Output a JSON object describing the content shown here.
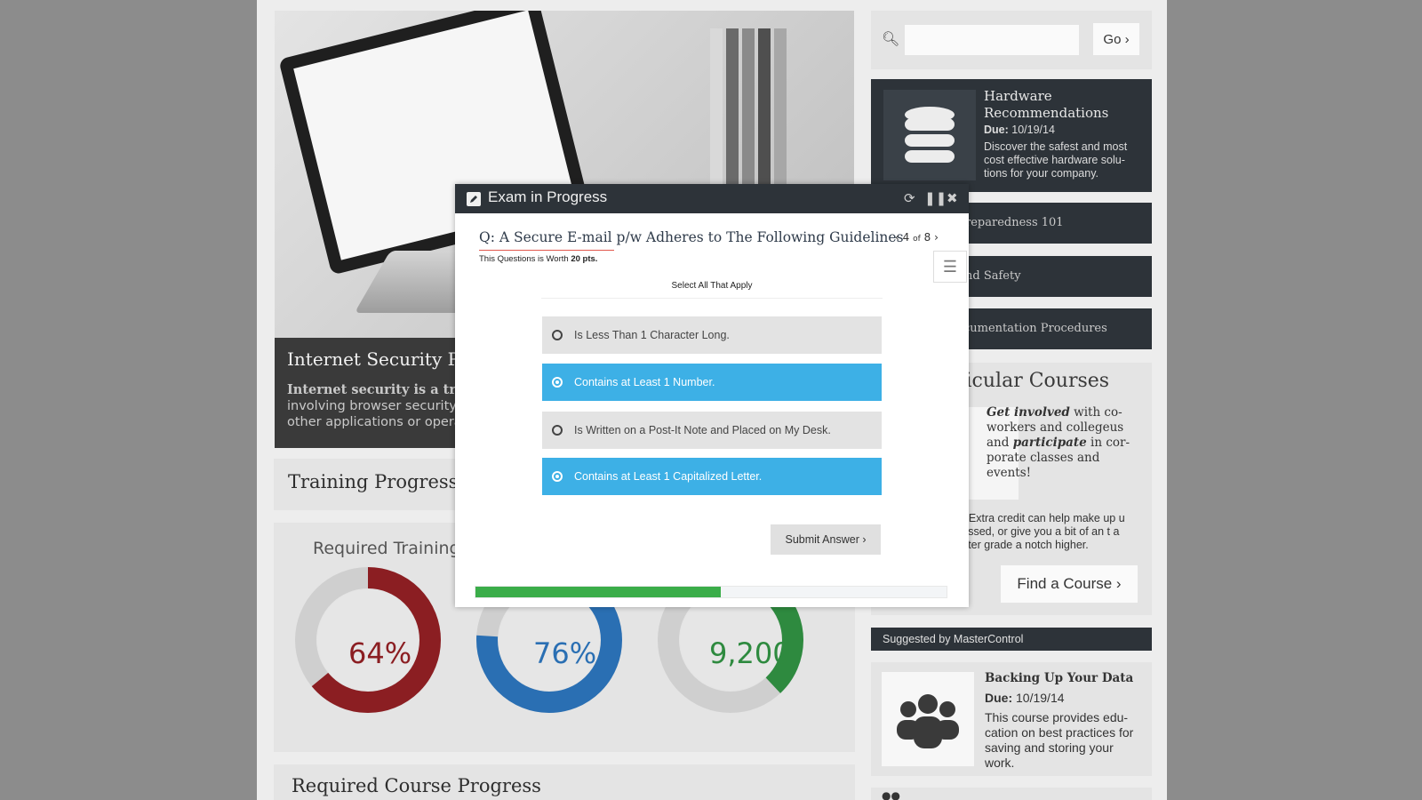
{
  "hero": {
    "title": "Internet Security Pol",
    "text_lines": [
      "Internet security is a tree bra",
      "involving browser security be",
      "other applications or operat"
    ]
  },
  "training": {
    "title": "Training Progress",
    "required_label": "Required Training",
    "donuts": [
      {
        "value": "64%",
        "fill": 0.64,
        "color": "#8b1e22"
      },
      {
        "value": "76%",
        "fill": 0.76,
        "color": "#2a6fb3"
      },
      {
        "value": "9,200",
        "fill": 0.38,
        "color": "#2e8a3f"
      }
    ]
  },
  "required_course": {
    "title": "Required Course Progress"
  },
  "sidebar": {
    "go_label": "Go",
    "featured": {
      "title": "Hardware Recommendations",
      "due_label": "Due:",
      "due_date": "10/19/14",
      "desc": "Discover the safest and most cost effective hardware solu-tions for your company."
    },
    "strips": [
      "reparedness 101",
      "nd Safety",
      "cumentation Procedures"
    ],
    "extra": {
      "title": "ricular Courses",
      "body_a": "Get involved",
      "body_b": " with co-workers and collegeus and ",
      "body_c": "participate",
      "body_d": " in cor-porate classes and events!",
      "note": "t? Extra credit can help make up u missed, or give you a bit of an t a letter grade a notch higher.",
      "find_label": "Find a Course"
    },
    "suggested": "Suggested by MasterControl",
    "backup": {
      "title": "Backing Up Your Data",
      "due_label": "Due:",
      "due_date": "10/19/14",
      "desc": "This course provides edu-cation on best practices for saving and storing your work."
    }
  },
  "modal": {
    "title": "Exam in Progress",
    "question": "Q: A Secure E-mail p/w Adheres to The Following Guidelines",
    "pager_current": "4",
    "pager_of": "of",
    "pager_total": "8",
    "worth_prefix": "This Questions is Worth",
    "worth_points": "20 pts.",
    "instruction": "Select All That Apply",
    "options": [
      {
        "label": "Is Less Than 1 Character Long.",
        "selected": false
      },
      {
        "label": "Contains at Least 1 Number.",
        "selected": true
      },
      {
        "label": "Is Written on a Post-It Note and Placed on My Desk.",
        "selected": false
      },
      {
        "label": "Contains at Least 1 Capitalized Letter.",
        "selected": true
      }
    ],
    "submit_label": "Submit Answer",
    "progress": 0.52
  }
}
